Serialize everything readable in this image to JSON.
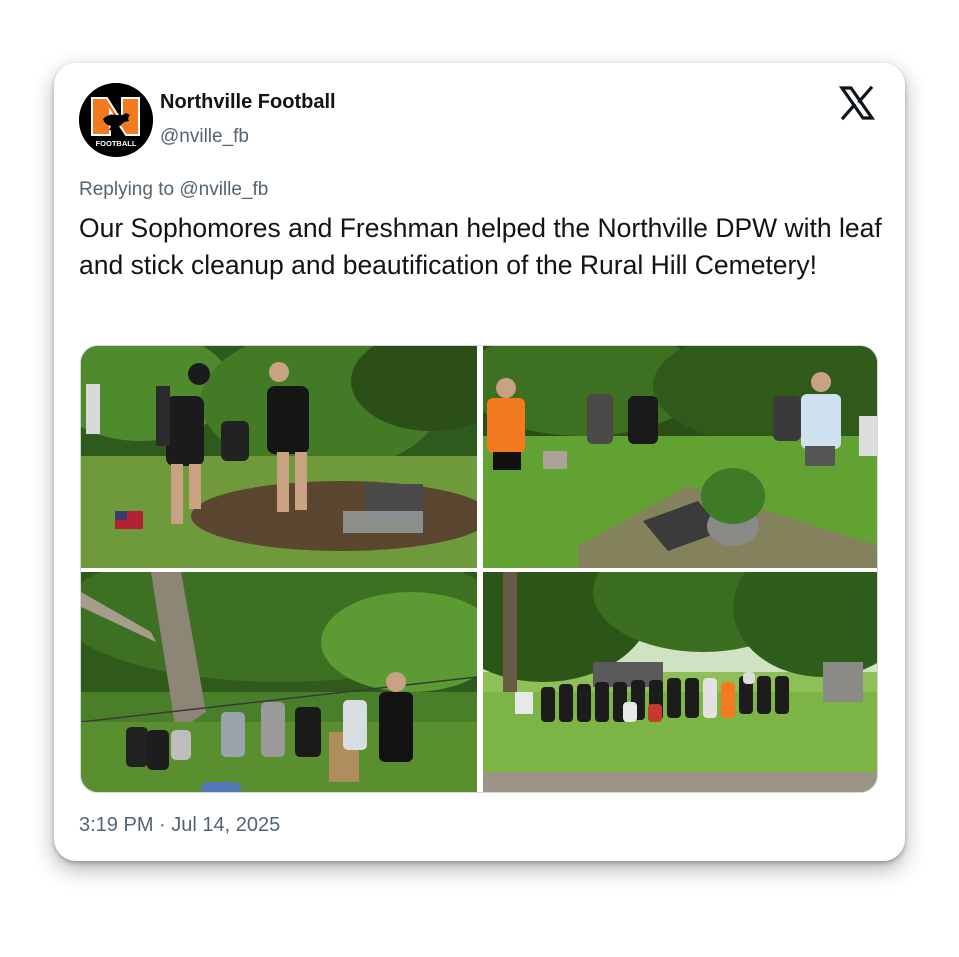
{
  "author": {
    "display_name": "Northville Football",
    "handle": "@nville_fb",
    "avatar_letter": "N",
    "avatar_caption": "FOOTBALL"
  },
  "reply": {
    "prefix": "Replying to",
    "handle": "@nville_fb"
  },
  "tweet": {
    "text": "Our Sophomores and Freshman helped the Northville DPW with leaf and stick cleanup and beautification of the Rural Hill Cemetery!"
  },
  "media": [
    {
      "name": "photo-cleanup-1"
    },
    {
      "name": "photo-cleanup-2"
    },
    {
      "name": "photo-cleanup-3"
    },
    {
      "name": "photo-group"
    }
  ],
  "meta": {
    "time": "3:19 PM",
    "separator": "·",
    "date": "Jul 14, 2025"
  },
  "icons": {
    "platform": "x-logo-icon"
  },
  "colors": {
    "brand_orange": "#f47a20",
    "text_primary": "#0f1419",
    "text_secondary": "#536471"
  }
}
